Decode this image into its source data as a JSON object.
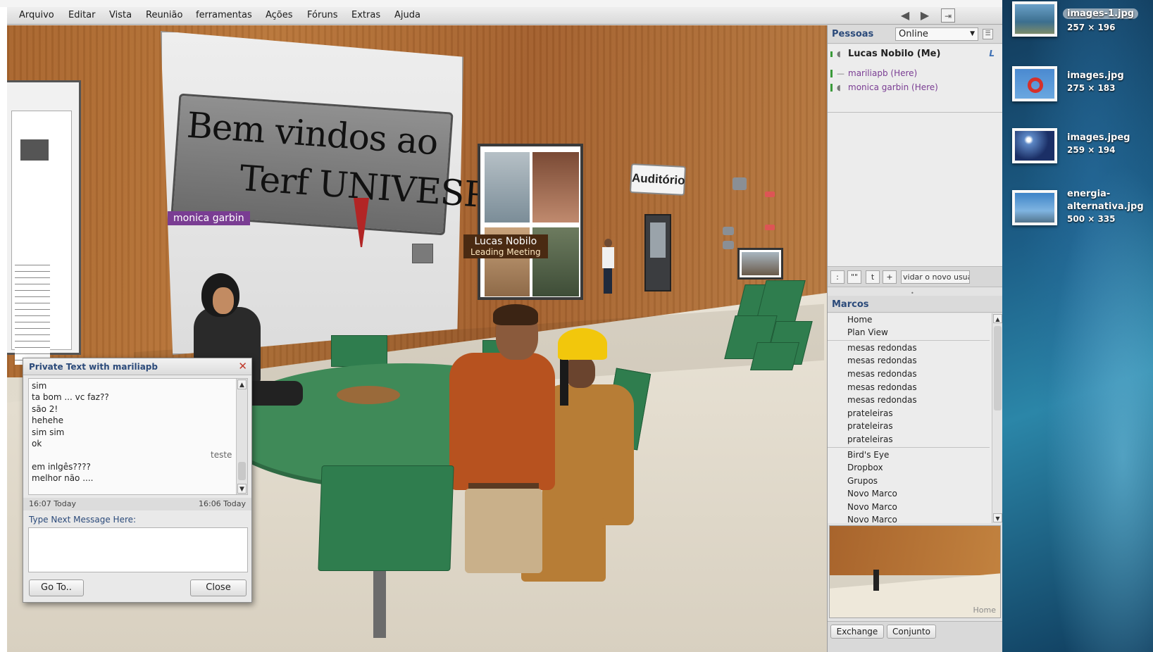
{
  "menubar": {
    "items": [
      "Arquivo",
      "Editar",
      "Vista",
      "Reunião",
      "ferramentas",
      "Ações",
      "Fóruns",
      "Extras",
      "Ajuda"
    ],
    "back_icon": "arrow-left-icon",
    "forward_icon": "arrow-right-icon",
    "exit_icon": "exit-icon"
  },
  "scene": {
    "welcome_line1": "Bem vindos ao",
    "welcome_line2": "Terf UNIVESP",
    "auditorio_sign": "Auditório",
    "tags": {
      "monica": "monica garbin",
      "lucas": "Lucas Nobilo",
      "lucas_sub": "Leading Meeting"
    }
  },
  "chat": {
    "title": "Private Text with mariliapb",
    "messages": [
      "sim",
      "ta bom ... vc faz??",
      "são 2!",
      "hehehe",
      "sim sim",
      "ok"
    ],
    "own_message": "teste",
    "messages_after": [
      "em inlgês????",
      "melhor não ...."
    ],
    "time_left": "16:07 Today",
    "time_right": "16:06 Today",
    "prompt": "Type Next Message Here:",
    "input_value": "",
    "goto_label": "Go To..",
    "close_label": "Close"
  },
  "people": {
    "title": "Pessoas",
    "status": "Online",
    "me": "Lucas Nobilo  (Me)",
    "me_flag": "L",
    "others": [
      "mariliapb  (Here)",
      "monica garbin  (Here)"
    ],
    "tools": [
      ":",
      "\"\"",
      "t",
      "+"
    ],
    "invite_placeholder": "vidar o novo usuá"
  },
  "marks": {
    "title": "Marcos",
    "group1": [
      "Home",
      "Plan View"
    ],
    "group2": [
      "mesas redondas",
      "mesas redondas",
      "mesas redondas",
      "mesas redondas",
      "mesas redondas",
      "prateleiras",
      "prateleiras",
      "prateleiras"
    ],
    "group3": [
      "Bird's Eye",
      "Dropbox",
      "Grupos",
      "Novo Marco",
      "Novo Marco",
      "Novo Marco"
    ]
  },
  "minimap": {
    "label": "Home"
  },
  "sidebar_tabs": [
    "Exchange",
    "Conjunto"
  ],
  "desktop": {
    "files": [
      {
        "name": "images-1.jpg",
        "dims": "257 × 196"
      },
      {
        "name": "images.jpg",
        "dims": "275 × 183"
      },
      {
        "name": "images.jpeg",
        "dims": "259 × 194"
      },
      {
        "name": "energia-",
        "name2": "alternativa.jpg",
        "dims": "500 × 335"
      }
    ]
  }
}
